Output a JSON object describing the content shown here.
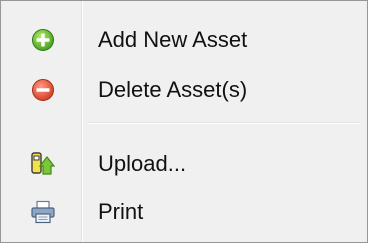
{
  "menu": {
    "items": [
      {
        "label": "Add New Asset",
        "icon": "add-icon",
        "color": "#5cb82c"
      },
      {
        "label": "Delete Asset(s)",
        "icon": "delete-icon",
        "color": "#e0533b"
      },
      {
        "label": "Upload...",
        "icon": "upload-icon",
        "color": "#8cc63f"
      },
      {
        "label": "Print",
        "icon": "print-icon",
        "color": "#5b7aa0"
      }
    ]
  }
}
